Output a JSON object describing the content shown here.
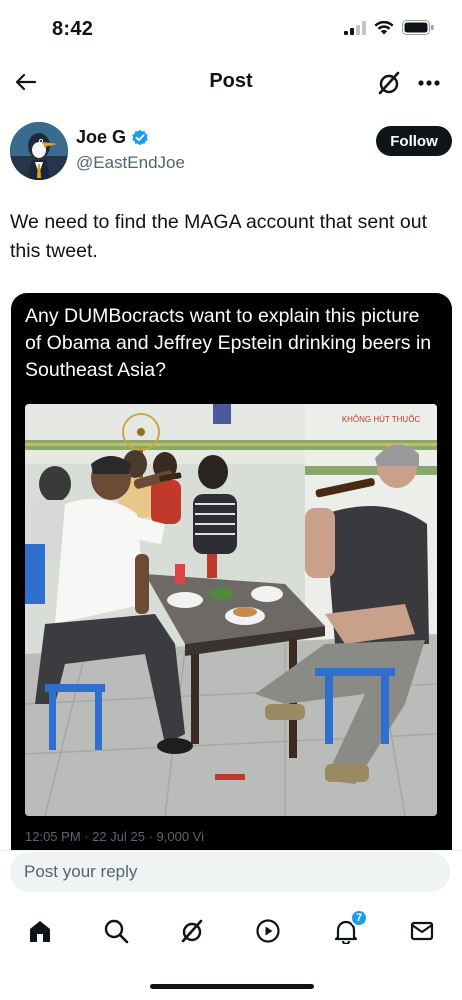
{
  "status": {
    "time": "8:42"
  },
  "nav": {
    "title": "Post"
  },
  "author": {
    "name": "Joe G",
    "handle": "@EastEndJoe",
    "follow_label": "Follow",
    "verified": true
  },
  "tweet": {
    "text": "We need to find the MAGA account that sent out this tweet."
  },
  "embedded_post": {
    "text": "Any DUMBocracts want to explain this picture of Obama and Jeffrey Epstein drinking beers in Southeast Asia?",
    "photo_sign_text": "KHÔNG HÚT THUỐC",
    "meta_partial": "12:05 PM · 22 Jul 25 · 9,000 Vi"
  },
  "reply": {
    "placeholder": "Post your reply"
  },
  "tabs": {
    "notifications_badge": "7"
  },
  "colors": {
    "accent": "#1d9bf0",
    "text": "#0f1419",
    "muted": "#536471"
  }
}
